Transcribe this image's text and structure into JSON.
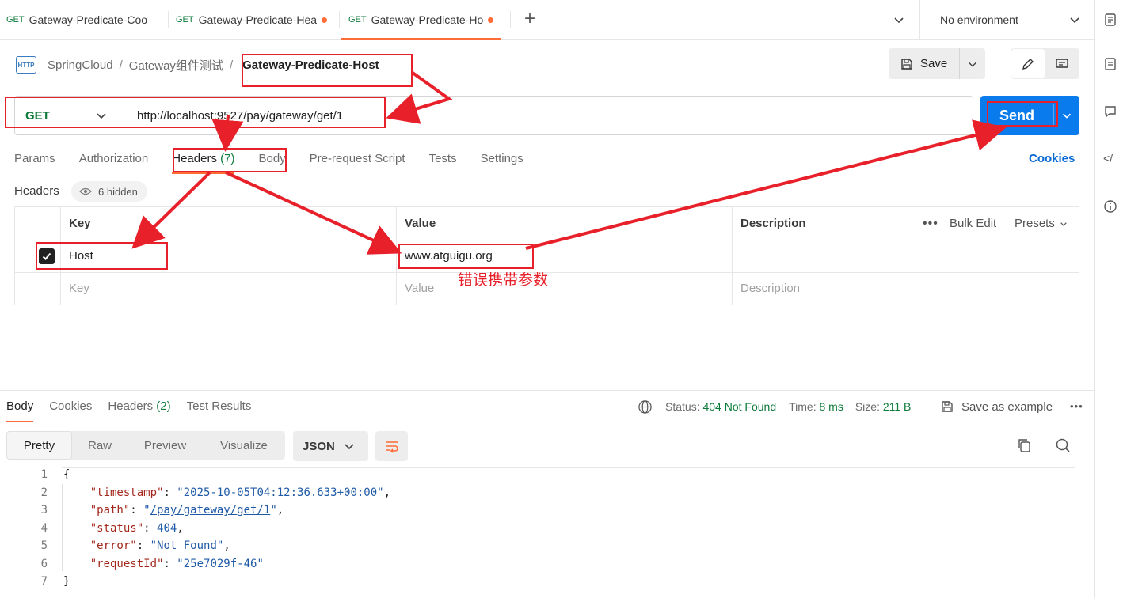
{
  "tabs": [
    {
      "method": "GET",
      "label": "Gateway-Predicate-Coo"
    },
    {
      "method": "GET",
      "label": "Gateway-Predicate-Hea"
    },
    {
      "method": "GET",
      "label": "Gateway-Predicate-Ho"
    }
  ],
  "environment": "No environment",
  "breadcrumb": {
    "icon_text": "HTTP",
    "items": [
      "SpringCloud",
      "Gateway组件测试"
    ],
    "current": "Gateway-Predicate-Host"
  },
  "toolbar": {
    "save_label": "Save"
  },
  "request": {
    "method": "GET",
    "url": "http://localhost:9527/pay/gateway/get/1",
    "send_label": "Send"
  },
  "request_tabs": {
    "params": "Params",
    "authorization": "Authorization",
    "headers": "Headers",
    "headers_count": "(7)",
    "body": "Body",
    "prerequest": "Pre-request Script",
    "tests": "Tests",
    "settings": "Settings",
    "cookies": "Cookies"
  },
  "headers_section": {
    "title": "Headers",
    "hidden": "6 hidden"
  },
  "headers_table": {
    "col_key": "Key",
    "col_value": "Value",
    "col_description": "Description",
    "bulk_edit": "Bulk Edit",
    "presets": "Presets",
    "rows": [
      {
        "key": "Host",
        "value": "www.atguigu.org",
        "description": "",
        "checked": true
      }
    ],
    "placeholder": {
      "key": "Key",
      "value": "Value",
      "description": "Description"
    }
  },
  "annotation": {
    "note": "错误携带参数"
  },
  "response": {
    "tabs": {
      "body": "Body",
      "cookies": "Cookies",
      "headers": "Headers",
      "headers_count": "(2)",
      "test_results": "Test Results"
    },
    "status_label": "Status:",
    "status_value": "404 Not Found",
    "time_label": "Time:",
    "time_value": "8 ms",
    "size_label": "Size:",
    "size_value": "211 B",
    "save_example": "Save as example",
    "views": [
      "Pretty",
      "Raw",
      "Preview",
      "Visualize"
    ],
    "format": "JSON",
    "lines": [
      "1",
      "2",
      "3",
      "4",
      "5",
      "6",
      "7"
    ],
    "json": {
      "timestamp_key": "\"timestamp\"",
      "timestamp": "\"2025-10-05T04:12:36.633+00:00\"",
      "path_key": "\"path\"",
      "path": "/pay/gateway/get/1",
      "status_key": "\"status\"",
      "status": "404",
      "error_key": "\"error\"",
      "error": "\"Not Found\"",
      "requestId_key": "\"requestId\"",
      "requestId": "\"25e7029f-46\""
    }
  },
  "colors": {
    "accent": "#ff6c37",
    "send": "#097bed",
    "get": "#0b7a39",
    "annotation": "#e8202a"
  }
}
